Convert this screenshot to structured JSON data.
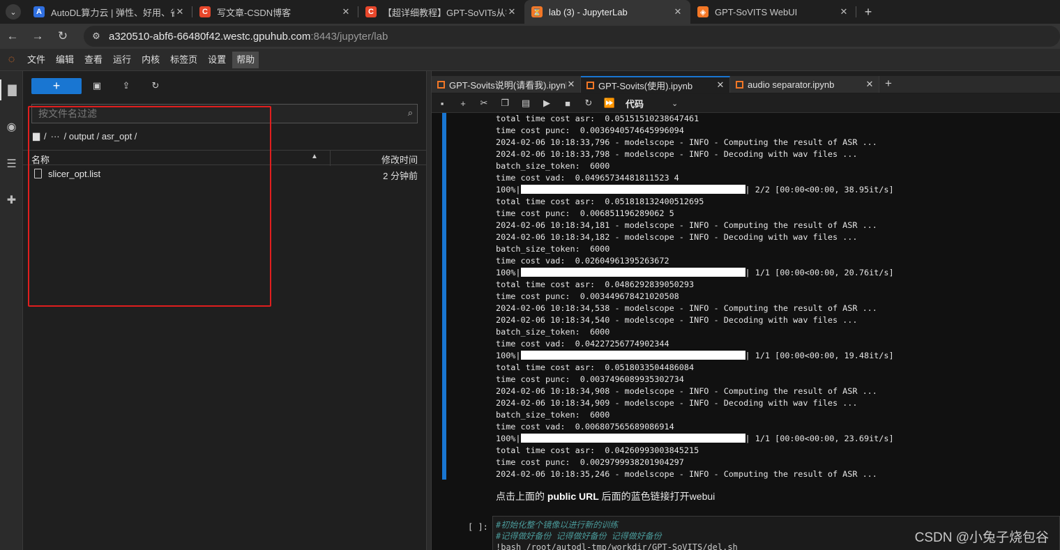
{
  "browser": {
    "tabs": [
      {
        "title": "AutoDL算力云 | 弹性、好用、省",
        "favicon": "A",
        "favicon_color": "#2f6fe0"
      },
      {
        "title": "写文章-CSDN博客",
        "favicon": "C",
        "favicon_color": "#e8472b"
      },
      {
        "title": "【超详细教程】GPT-SoVITs从零",
        "favicon": "C",
        "favicon_color": "#e8472b"
      },
      {
        "title": "lab (3) - JupyterLab",
        "favicon": "⏳",
        "favicon_color": "#f37726"
      },
      {
        "title": "GPT-SoVITS WebUI",
        "favicon": "◈",
        "favicon_color": "#f37726"
      }
    ],
    "active_tab_index": 3,
    "url_host": "a320510-abf6-66480f42.westc.gpuhub.com",
    "url_rest": ":8443/jupyter/lab"
  },
  "menubar": {
    "items": [
      "文件",
      "编辑",
      "查看",
      "运行",
      "内核",
      "标签页",
      "设置",
      "帮助"
    ],
    "active": "帮助"
  },
  "filebrowser": {
    "new_label": "+",
    "filter_placeholder": "按文件名过滤",
    "breadcrumb": [
      "/",
      "···",
      "/ output / asr_opt /"
    ],
    "col_name": "名称",
    "col_modified": "修改时间",
    "files": [
      {
        "name": "slicer_opt.list",
        "modified": "2 分钟前"
      }
    ]
  },
  "notebook": {
    "tabs": [
      {
        "title": "GPT-Sovits说明(请看我).ipynb"
      },
      {
        "title": "GPT-Sovits(使用).ipynb"
      },
      {
        "title": "audio separator.ipynb"
      }
    ],
    "active_tab_index": 1,
    "cell_type": "代码",
    "output_lines": [
      "total time cost asr:  0.05151510238647461",
      "time cost punc:  0.0036940574645996094",
      "2024-02-06 10:18:33,796 - modelscope - INFO - Computing the result of ASR ...",
      "2024-02-06 10:18:33,798 - modelscope - INFO - Decoding with wav files ...",
      "batch_size_token:  6000",
      "time cost vad:  0.04965734481811523 4",
      "100%|@@BAR@@| 2/2 [00:00<00:00, 38.95it/s]",
      "total time cost asr:  0.051818132400512695",
      "time cost punc:  0.006851196289062 5",
      "2024-02-06 10:18:34,181 - modelscope - INFO - Computing the result of ASR ...",
      "2024-02-06 10:18:34,182 - modelscope - INFO - Decoding with wav files ...",
      "batch_size_token:  6000",
      "time cost vad:  0.02604961395263672",
      "100%|@@BAR@@| 1/1 [00:00<00:00, 20.76it/s]",
      "total time cost asr:  0.0486292839050293",
      "time cost punc:  0.003449678421020508",
      "2024-02-06 10:18:34,538 - modelscope - INFO - Computing the result of ASR ...",
      "2024-02-06 10:18:34,540 - modelscope - INFO - Decoding with wav files ...",
      "batch_size_token:  6000",
      "time cost vad:  0.04227256774902344",
      "100%|@@BAR@@| 1/1 [00:00<00:00, 19.48it/s]",
      "total time cost asr:  0.0518033504486084",
      "time cost punc:  0.0037496089935302734",
      "2024-02-06 10:18:34,908 - modelscope - INFO - Computing the result of ASR ...",
      "2024-02-06 10:18:34,909 - modelscope - INFO - Decoding with wav files ...",
      "batch_size_token:  6000",
      "time cost vad:  0.006807565689086914",
      "100%|@@BAR@@| 1/1 [00:00<00:00, 23.69it/s]",
      "total time cost asr:  0.04260993003845215",
      "time cost punc:  0.0029799938201904297",
      "2024-02-06 10:18:35,246 - modelscope - INFO - Computing the result of ASR ..."
    ],
    "markdown_pre": "点击上面的 ",
    "markdown_bold": "public URL",
    "markdown_post": " 后面的蓝色链接打开webui",
    "next_prompt": "[ ]:",
    "code_lines": [
      "#初始化整个镜像以进行新的训练",
      "#记得做好备份 记得做好备份 记得做好备份",
      "!bash /root/autodl-tmp/workdir/GPT-SoVITS/del.sh"
    ]
  },
  "watermark": "CSDN @小兔子烧包谷",
  "colors": {
    "accent": "#1976d2",
    "jupyter_orange": "#f37726",
    "highlight_box": "#e01e1e"
  }
}
